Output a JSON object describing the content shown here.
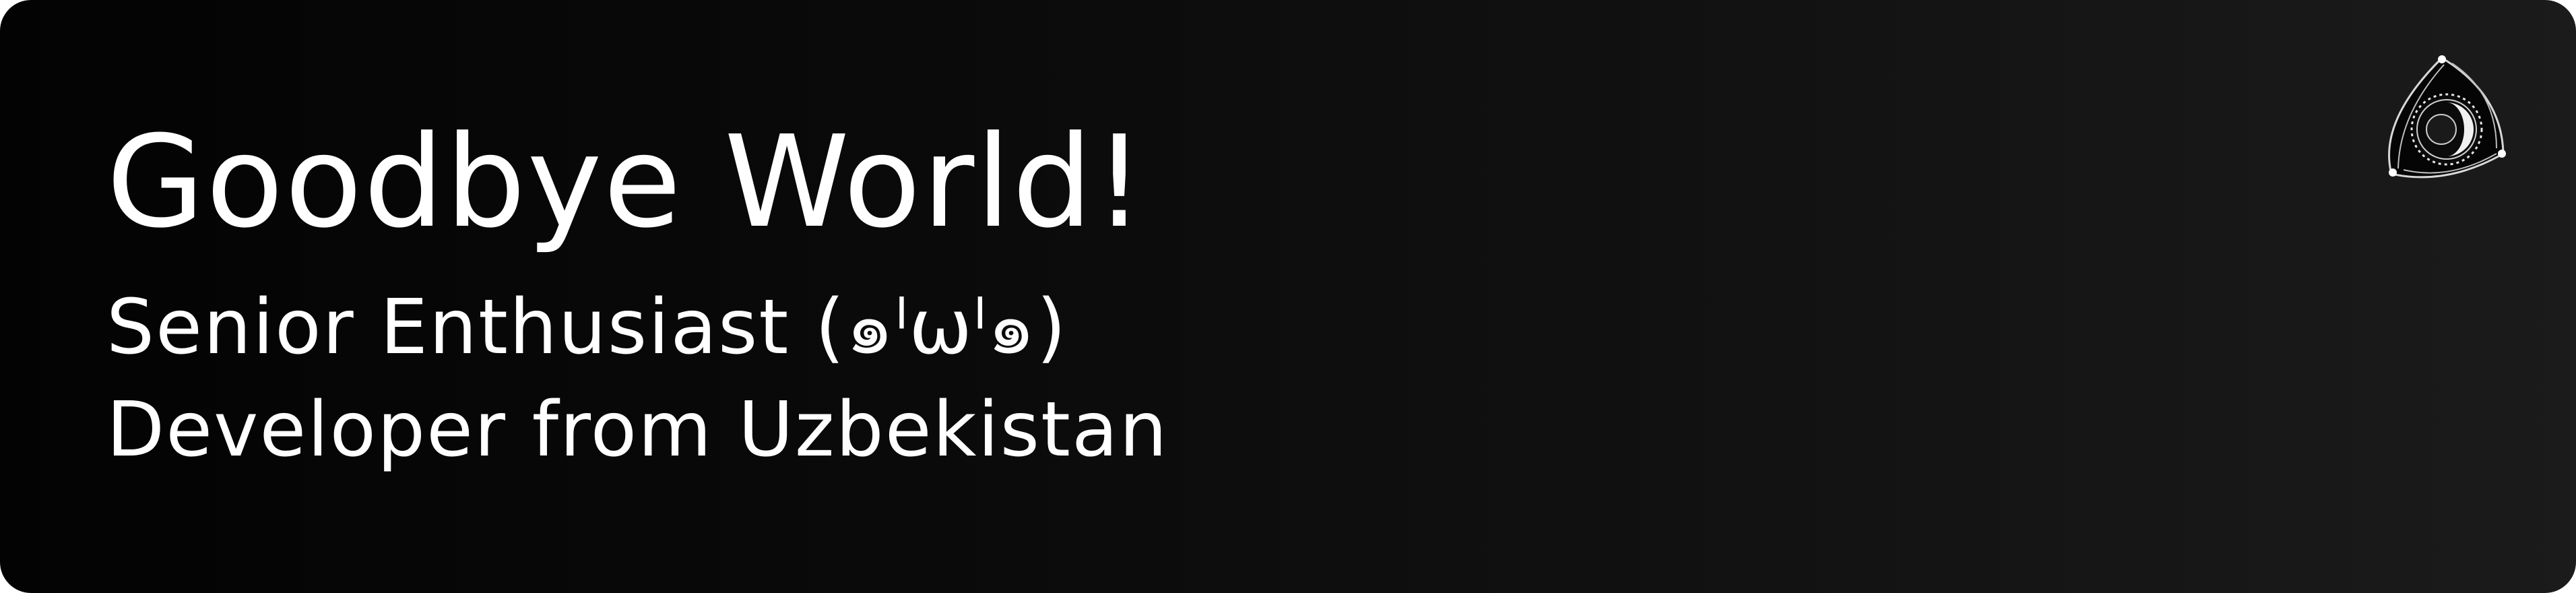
{
  "banner": {
    "title": "Goodbye World!",
    "subtitle_line1": "Senior Enthusiast  (๑ˡωˡ๑)",
    "subtitle_line2": "Developer from Uzbekistan",
    "logo_icon": "rotary-engine-icon",
    "colors": {
      "background_start": "#030303",
      "background_end": "#1b1b1b",
      "text": "#ffffff"
    }
  }
}
